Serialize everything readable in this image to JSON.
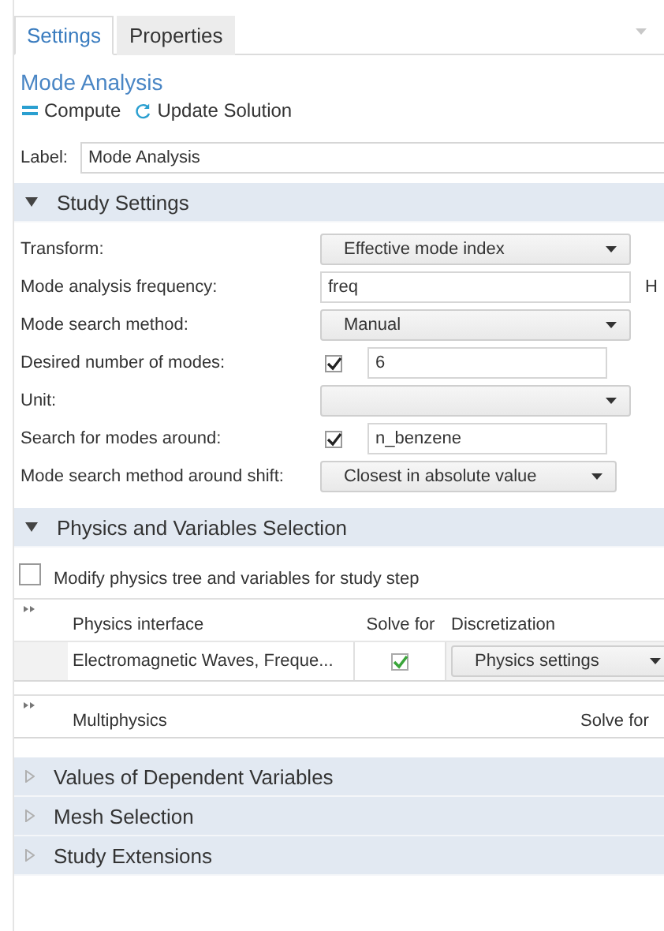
{
  "tabs": [
    {
      "label": "Settings",
      "selected": true
    },
    {
      "label": "Properties",
      "selected": false
    }
  ],
  "title": "Mode Analysis",
  "toolbar": [
    {
      "label": "Compute",
      "kind": "compute"
    },
    {
      "label": "Update Solution",
      "kind": "update"
    }
  ],
  "label_field": {
    "label": "Label:",
    "value": "Mode Analysis"
  },
  "sections": [
    {
      "title": "Study Settings",
      "expanded": true,
      "kind": "study_settings",
      "rows": [
        {
          "label": "Transform:",
          "kind": "dropdown",
          "value": "Effective mode index"
        },
        {
          "label": "Mode analysis frequency:",
          "kind": "text",
          "value": "freq",
          "unit": "H"
        },
        {
          "label": "Mode search method:",
          "kind": "dropdown",
          "value": "Manual"
        },
        {
          "label": "Desired number of modes:",
          "kind": "check_text",
          "checked": true,
          "value": "6"
        },
        {
          "label": "Unit:",
          "kind": "dropdown"
        },
        {
          "label": "Search for modes around:",
          "kind": "check_text",
          "checked": true,
          "value": "n_benzene"
        },
        {
          "label": "Mode search method around shift:",
          "kind": "dropdown",
          "value": "Closest in absolute value"
        }
      ]
    },
    {
      "title": "Physics and Variables Selection",
      "expanded": true,
      "kind": "physics_selection",
      "modify": {
        "label": "Modify physics tree and variables for study step",
        "checked": false
      },
      "physics_table": {
        "columns": [
          "Physics interface",
          "Solve for",
          "Discretization"
        ],
        "rows": [
          {
            "interface": "Electromagnetic Waves, Freque...",
            "solve_for": true,
            "discretization": "Physics settings"
          }
        ]
      },
      "multiphysics_table": {
        "columns": [
          "Multiphysics",
          "Solve for"
        ]
      }
    },
    {
      "title": "Values of Dependent Variables",
      "expanded": false
    },
    {
      "title": "Mesh Selection",
      "expanded": false
    },
    {
      "title": "Study Extensions",
      "expanded": false
    }
  ]
}
